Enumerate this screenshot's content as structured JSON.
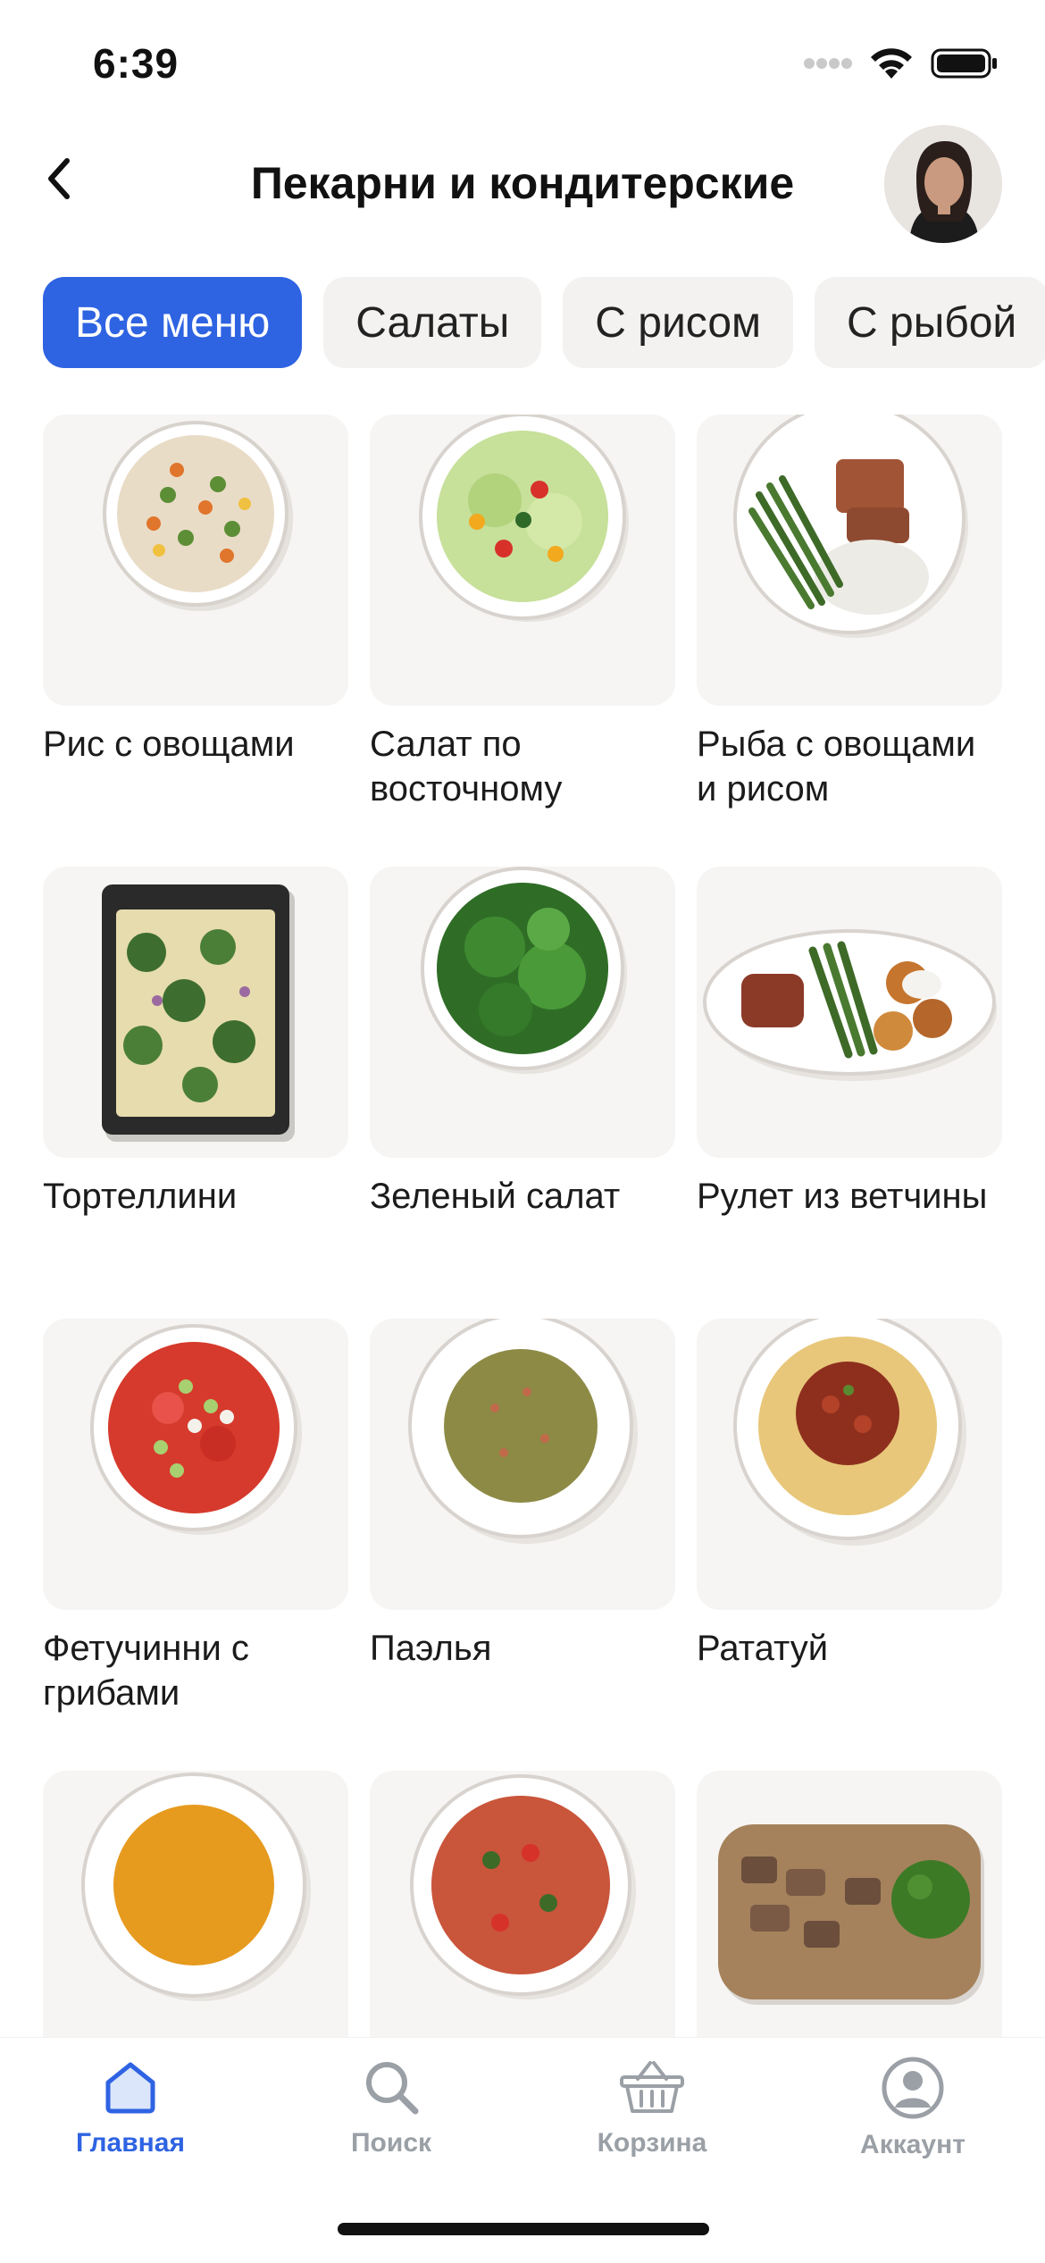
{
  "status_bar": {
    "time": "6:39"
  },
  "header": {
    "title": "Пекарни и кондитерские"
  },
  "chips": [
    "Все меню",
    "Салаты",
    "С рисом",
    "С рыбой"
  ],
  "items": [
    {
      "title": "Рис с овощами"
    },
    {
      "title": "Салат по восточному"
    },
    {
      "title": "Рыба с овощами и рисом"
    },
    {
      "title": "Тортеллини"
    },
    {
      "title": "Зеленый салат"
    },
    {
      "title": "Рулет из ветчины"
    },
    {
      "title": "Фетучинни с грибами"
    },
    {
      "title": "Паэлья"
    },
    {
      "title": "Рататуй"
    },
    {
      "title": ""
    },
    {
      "title": ""
    },
    {
      "title": ""
    }
  ],
  "tabbar": {
    "tabs": [
      {
        "label": "Главная",
        "icon": "home-icon"
      },
      {
        "label": "Поиск",
        "icon": "search-icon"
      },
      {
        "label": "Корзина",
        "icon": "basket-icon"
      },
      {
        "label": "Аккаунт",
        "icon": "account-icon"
      }
    ],
    "active_index": 0
  },
  "colors": {
    "accent": "#2e63e2",
    "chip_bg": "#f3f2f1",
    "card_bg": "#f6f5f3",
    "inactive": "#9aa0a6"
  }
}
